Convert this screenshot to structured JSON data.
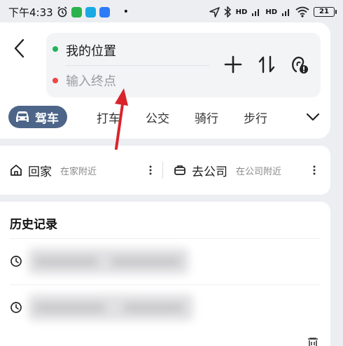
{
  "status_bar": {
    "time": "下午4:33",
    "battery": "21",
    "network_labels": [
      "HD",
      "HD"
    ],
    "app_colors": [
      "#2bb24c",
      "#19a9e5",
      "#2e7bf6"
    ]
  },
  "route": {
    "start_label": "我的位置",
    "end_placeholder": "输入终点",
    "start_dot_color": "#21b35c",
    "end_dot_color": "#f04646"
  },
  "toolbar": {
    "add_icon": "plus-icon",
    "swap_icon": "swap-vertical-icon",
    "voice_icon": "voice-mic-icon"
  },
  "modes": {
    "tabs": [
      {
        "label": "驾车",
        "active": true
      },
      {
        "label": "打车",
        "active": false
      },
      {
        "label": "公交",
        "active": false
      },
      {
        "label": "骑行",
        "active": false
      },
      {
        "label": "步行",
        "active": false
      }
    ],
    "active_color": "#4d6588"
  },
  "shortcuts": {
    "home": {
      "label": "回家",
      "sub": "在家附近"
    },
    "work": {
      "label": "去公司",
      "sub": "在公司附近"
    }
  },
  "history": {
    "title": "历史记录"
  },
  "annotation": {
    "arrow_color": "#d9242b"
  }
}
